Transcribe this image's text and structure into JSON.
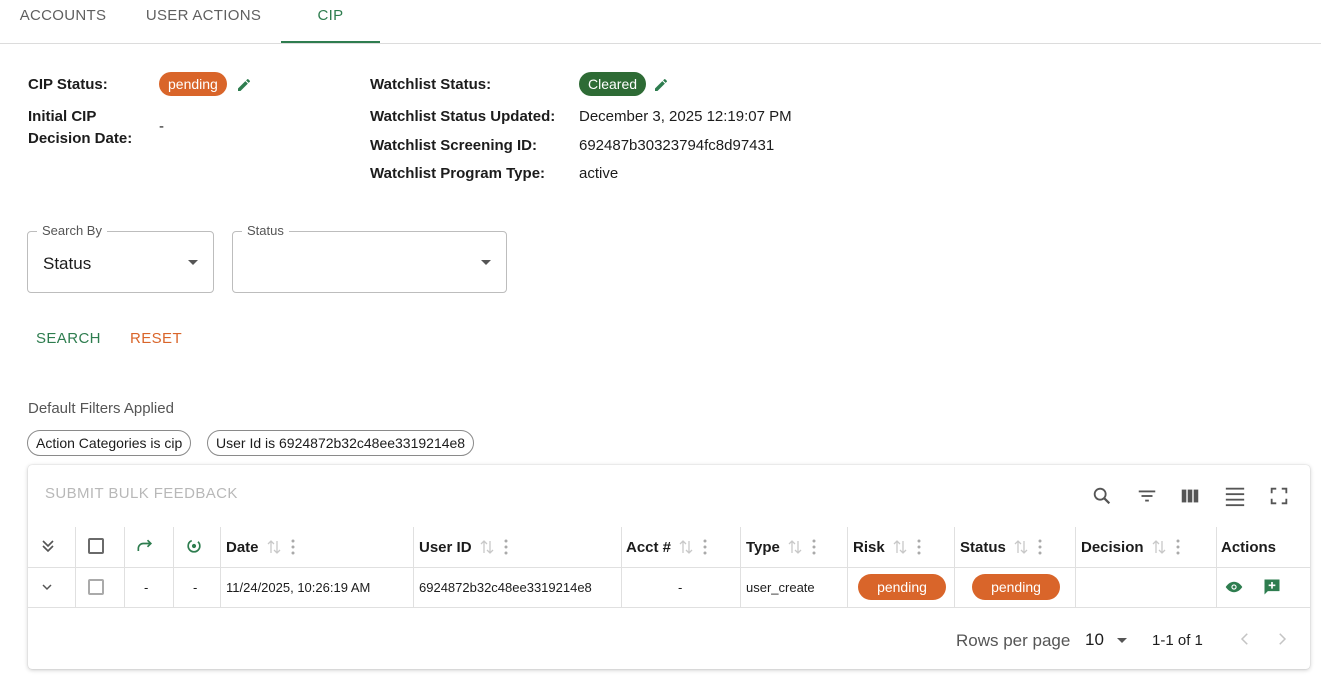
{
  "tabs": [
    {
      "label": "ACCOUNTS"
    },
    {
      "label": "USER ACTIONS"
    },
    {
      "label": "CIP"
    }
  ],
  "cip": {
    "status_label": "CIP Status:",
    "status_value": "pending",
    "initial_label_line1": "Initial CIP",
    "initial_label_line2": "Decision Date:",
    "initial_value": "-"
  },
  "watchlist": {
    "status_label": "Watchlist Status:",
    "status_value": "Cleared",
    "updated_label": "Watchlist Status Updated:",
    "updated_value": "December 3, 2025 12:19:07 PM",
    "screening_label": "Watchlist Screening ID:",
    "screening_value": "692487b30323794fc8d97431",
    "program_label": "Watchlist Program Type:",
    "program_value": "active"
  },
  "search": {
    "search_by_label": "Search By",
    "search_by_value": "Status",
    "status_label": "Status",
    "status_value": "",
    "search_button": "SEARCH",
    "reset_button": "RESET"
  },
  "filters": {
    "label": "Default Filters Applied",
    "chips": [
      "Action Categories is cip",
      "User Id is 6924872b32c48ee3319214e8"
    ]
  },
  "table": {
    "bulk_feedback": "SUBMIT BULK FEEDBACK",
    "toolbar_icons": [
      "search-icon",
      "filter-icon",
      "columns-icon",
      "density-icon",
      "fullscreen-icon"
    ],
    "columns": {
      "date": "Date",
      "user_id": "User ID",
      "acct": "Acct #",
      "type": "Type",
      "risk": "Risk",
      "status": "Status",
      "decision": "Decision",
      "actions": "Actions"
    },
    "rows": [
      {
        "redirect": "-",
        "sync": "-",
        "date": "11/24/2025, 10:26:19 AM",
        "user_id": "6924872b32c48ee3319214e8",
        "acct": "-",
        "type": "user_create",
        "risk": "pending",
        "status": "pending",
        "decision": ""
      }
    ],
    "footer": {
      "rows_per_page_label": "Rows per page",
      "rows_per_page_value": "10",
      "range": "1-1 of 1"
    }
  },
  "colors": {
    "accent_green": "#2e7d4f",
    "pending_orange": "#d9652a",
    "cleared_green": "#2e6b35"
  }
}
